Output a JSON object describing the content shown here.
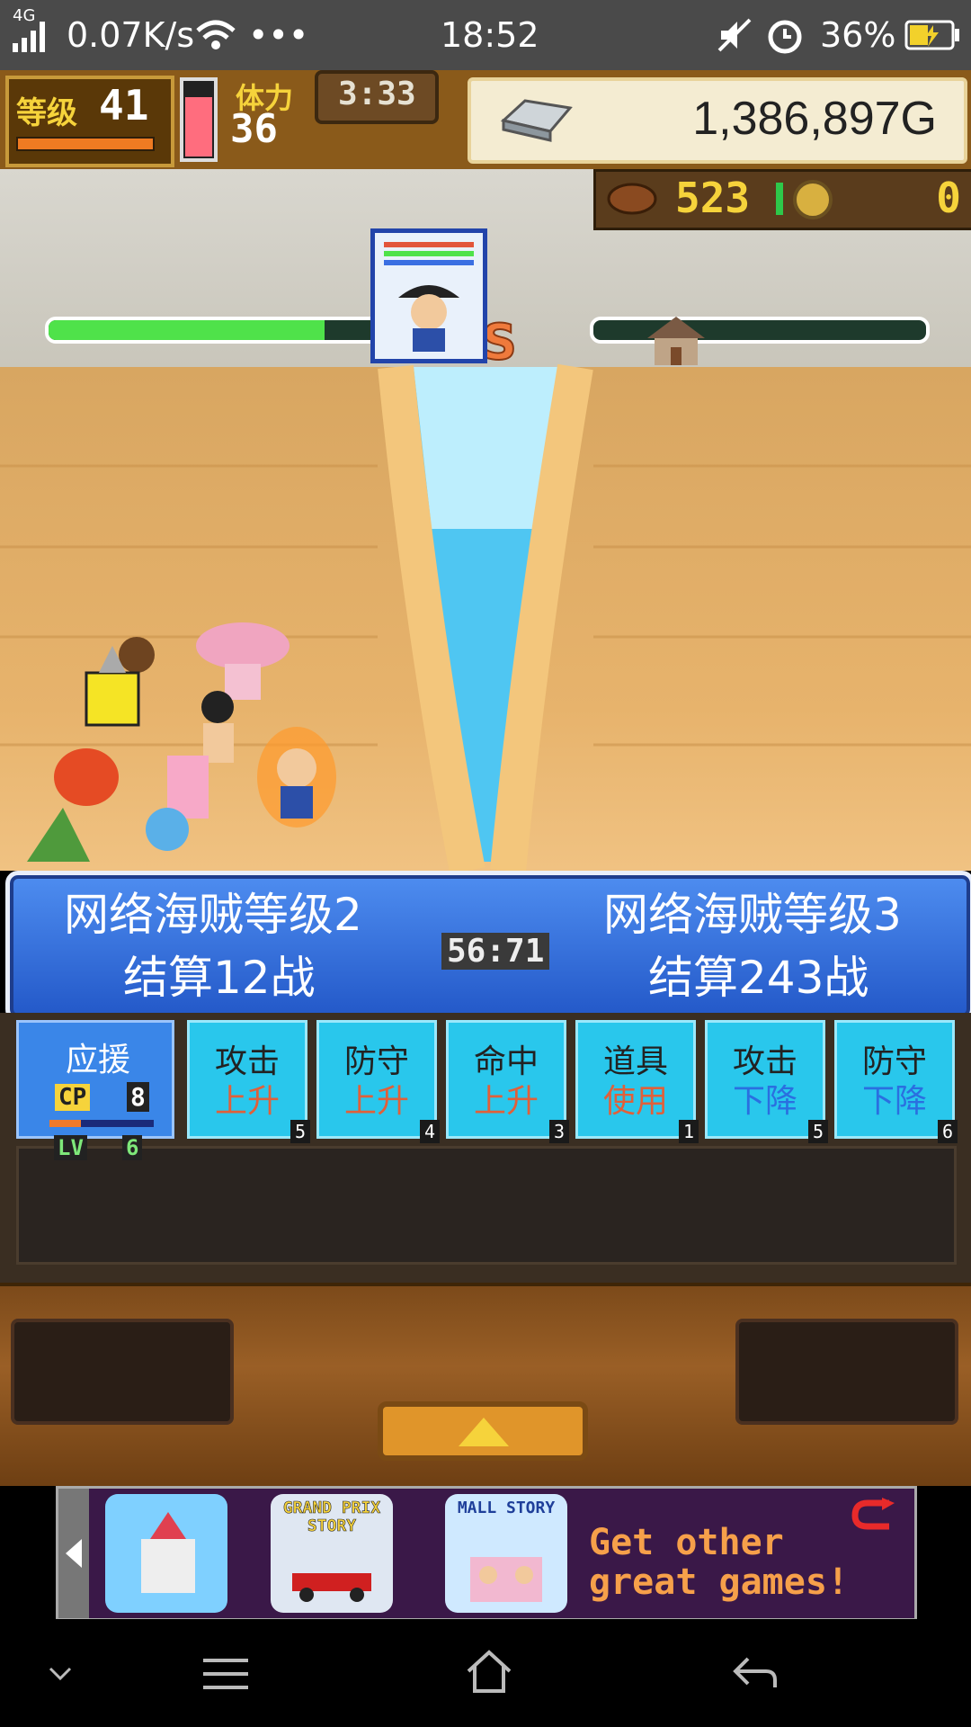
{
  "status_bar": {
    "network_type": "4G",
    "speed": "0.07K/s",
    "time": "18:52",
    "battery": "36%",
    "icons": [
      "signal-icon",
      "wifi-icon",
      "more-dots-icon",
      "mute-icon",
      "alarm-icon",
      "battery-icon"
    ]
  },
  "hud": {
    "level_label": "等级",
    "level_value": "41",
    "stamina_label": "体力",
    "stamina_value": "36",
    "timer": "3:33",
    "gold": "1,386,897G"
  },
  "resources": {
    "food": "523",
    "coins": "0"
  },
  "battle": {
    "vs_label": "Vs",
    "left_team_name": "网络海贼等级2",
    "left_result": "结算12战",
    "right_team_name": "网络海贼等级3",
    "right_result": "结算243战",
    "countdown": "56:71",
    "left_hp_fraction": 0.83,
    "right_hp_fraction": 0.0
  },
  "actions": {
    "support": {
      "label": "应援",
      "cp_label": "CP",
      "cp_value": "8",
      "lv_label": "LV",
      "lv_value": "6"
    },
    "buttons": [
      {
        "line1": "攻击",
        "line2": "上升",
        "count": "5",
        "line2_color": "#e0603a"
      },
      {
        "line1": "防守",
        "line2": "上升",
        "count": "4",
        "line2_color": "#e0603a"
      },
      {
        "line1": "命中",
        "line2": "上升",
        "count": "3",
        "line2_color": "#e0603a"
      },
      {
        "line1": "道具",
        "line2": "使用",
        "count": "1",
        "line2_color": "#e0603a"
      },
      {
        "line1": "攻击",
        "line2": "下降",
        "count": "5",
        "line2_color": "#2a6fe0"
      },
      {
        "line1": "防守",
        "line2": "下降",
        "count": "6",
        "line2_color": "#2a6fe0"
      }
    ]
  },
  "ad": {
    "game2_title": "GRAND PRIX STORY",
    "game3_title": "MALL STORY",
    "cta": "Get other great games!"
  },
  "nav_bar": {
    "icons": [
      "collapse-chevron-icon",
      "menu-icon",
      "home-icon",
      "back-icon"
    ]
  },
  "colors": {
    "hp_green": "#4fe24a",
    "banner_blue": "#3272dc",
    "action_cyan": "#29c7ec",
    "hud_brown": "#8a5a1a"
  }
}
